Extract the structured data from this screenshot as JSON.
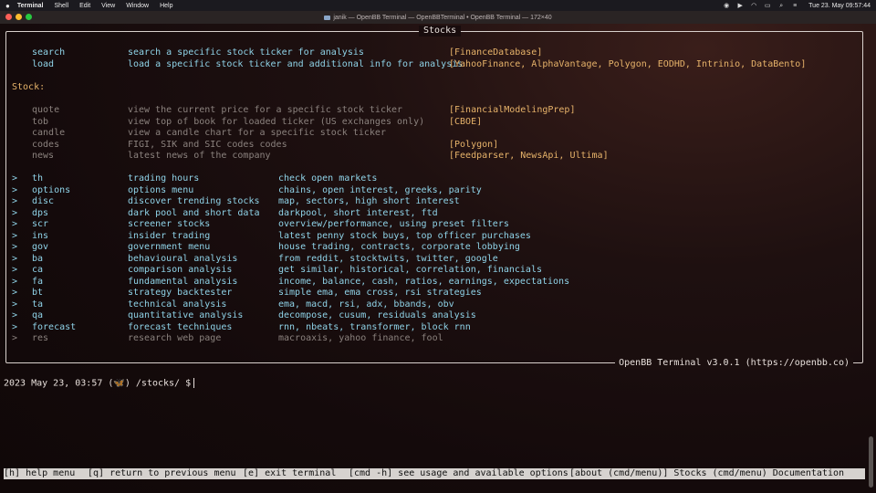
{
  "menubar": {
    "app": "Terminal",
    "menus": [
      "Shell",
      "Edit",
      "View",
      "Window",
      "Help"
    ],
    "clock": "Tue 23. May  09:57:44"
  },
  "window": {
    "title": "janik — OpenBB Terminal — OpenBBTerminal • OpenBB Terminal — 172×40"
  },
  "panel": {
    "title": "Stocks",
    "footer": "OpenBB Terminal v3.0.1 (https://openbb.co)"
  },
  "top_commands": [
    {
      "cmd": "search",
      "desc": "search a specific stock ticker for analysis",
      "source": "[FinanceDatabase]"
    },
    {
      "cmd": "load",
      "desc": "load a specific stock ticker and additional info for analysis",
      "source": "[YahooFinance, AlphaVantage, Polygon, EODHD, Intrinio, DataBento]"
    }
  ],
  "section_label": "Stock:",
  "stock_commands": [
    {
      "cmd": "quote",
      "desc": "view the current price for a specific stock ticker",
      "source": "[FinancialModelingPrep]"
    },
    {
      "cmd": "tob",
      "desc": "view top of book for loaded ticker (US exchanges only)",
      "source": "[CBOE]"
    },
    {
      "cmd": "candle",
      "desc": "view a candle chart for a specific stock ticker",
      "source": ""
    },
    {
      "cmd": "codes",
      "desc": "FIGI, SIK and SIC codes codes",
      "source": "[Polygon]"
    },
    {
      "cmd": "news",
      "desc": "latest news of the company",
      "source": "[Feedparser, NewsApi, Ultima]"
    }
  ],
  "menus": [
    {
      "arrow": ">",
      "cmd": "th",
      "name": "trading hours",
      "info": "check open markets",
      "dim": false
    },
    {
      "arrow": ">",
      "cmd": "options",
      "name": "options menu",
      "info": "chains, open interest, greeks, parity",
      "dim": false
    },
    {
      "arrow": ">",
      "cmd": "disc",
      "name": "discover trending stocks",
      "info": "map, sectors, high short interest",
      "dim": false
    },
    {
      "arrow": ">",
      "cmd": "dps",
      "name": "dark pool and short data",
      "info": "darkpool, short interest, ftd",
      "dim": false
    },
    {
      "arrow": ">",
      "cmd": "scr",
      "name": "screener stocks",
      "info": "overview/performance, using preset filters",
      "dim": false
    },
    {
      "arrow": ">",
      "cmd": "ins",
      "name": "insider trading",
      "info": "latest penny stock buys, top officer purchases",
      "dim": false
    },
    {
      "arrow": ">",
      "cmd": "gov",
      "name": "government menu",
      "info": "house trading, contracts, corporate lobbying",
      "dim": false
    },
    {
      "arrow": ">",
      "cmd": "ba",
      "name": "behavioural analysis",
      "info": "from reddit, stocktwits, twitter, google",
      "dim": false
    },
    {
      "arrow": ">",
      "cmd": "ca",
      "name": "comparison analysis",
      "info": "get similar, historical, correlation, financials",
      "dim": false
    },
    {
      "arrow": ">",
      "cmd": "fa",
      "name": "fundamental analysis",
      "info": "income, balance, cash, ratios, earnings, expectations",
      "dim": false
    },
    {
      "arrow": ">",
      "cmd": "bt",
      "name": "strategy backtester",
      "info": "simple ema, ema cross, rsi strategies",
      "dim": false
    },
    {
      "arrow": ">",
      "cmd": "ta",
      "name": "technical analysis",
      "info": "ema, macd, rsi, adx, bbands, obv",
      "dim": false
    },
    {
      "arrow": ">",
      "cmd": "qa",
      "name": "quantitative analysis",
      "info": "decompose, cusum, residuals analysis",
      "dim": false
    },
    {
      "arrow": ">",
      "cmd": "forecast",
      "name": "forecast techniques",
      "info": "rnn, nbeats, transformer, block rnn",
      "dim": false
    },
    {
      "arrow": ">",
      "cmd": "res",
      "name": "research web page",
      "info": "macroaxis, yahoo finance, fool",
      "dim": true
    }
  ],
  "prompt": "2023 May 23, 03:57 (🦋) /stocks/ $",
  "statusbar": {
    "help": "[h] help menu",
    "back": "[q] return to previous menu",
    "exit": "[e] exit terminal",
    "usage": "[cmd -h] see usage and available options",
    "about": "[about (cmd/menu)] Stocks (cmd/menu) Documentation"
  }
}
